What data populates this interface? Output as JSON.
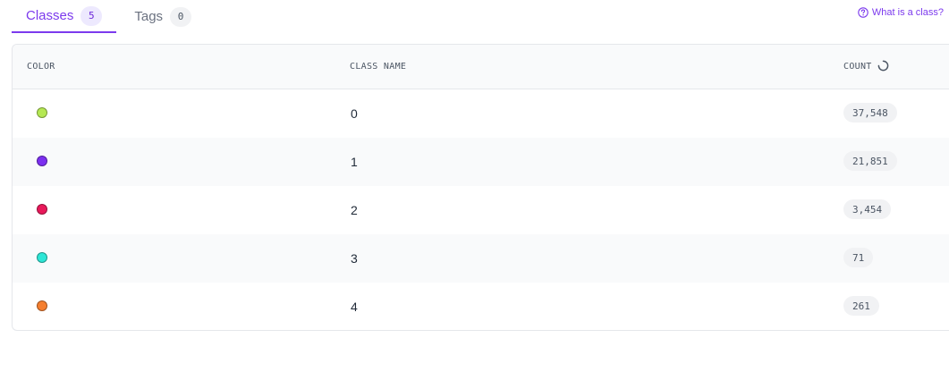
{
  "tabs": [
    {
      "label": "Classes",
      "count": "5",
      "active": true
    },
    {
      "label": "Tags",
      "count": "0",
      "active": false
    }
  ],
  "help_link": {
    "label": "What is a class?",
    "icon": "question-circle-icon"
  },
  "table": {
    "headers": {
      "color": "COLOR",
      "class_name": "CLASS NAME",
      "count": "COUNT"
    },
    "rows": [
      {
        "color": "#b5e853",
        "name": "0",
        "count": "37,548"
      },
      {
        "color": "#7c2ff0",
        "name": "1",
        "count": "21,851"
      },
      {
        "color": "#e8195a",
        "name": "2",
        "count": "3,454"
      },
      {
        "color": "#2ee6d6",
        "name": "3",
        "count": "71"
      },
      {
        "color": "#f57f2f",
        "name": "4",
        "count": "261"
      }
    ]
  },
  "accent_color": "#7c3aed"
}
